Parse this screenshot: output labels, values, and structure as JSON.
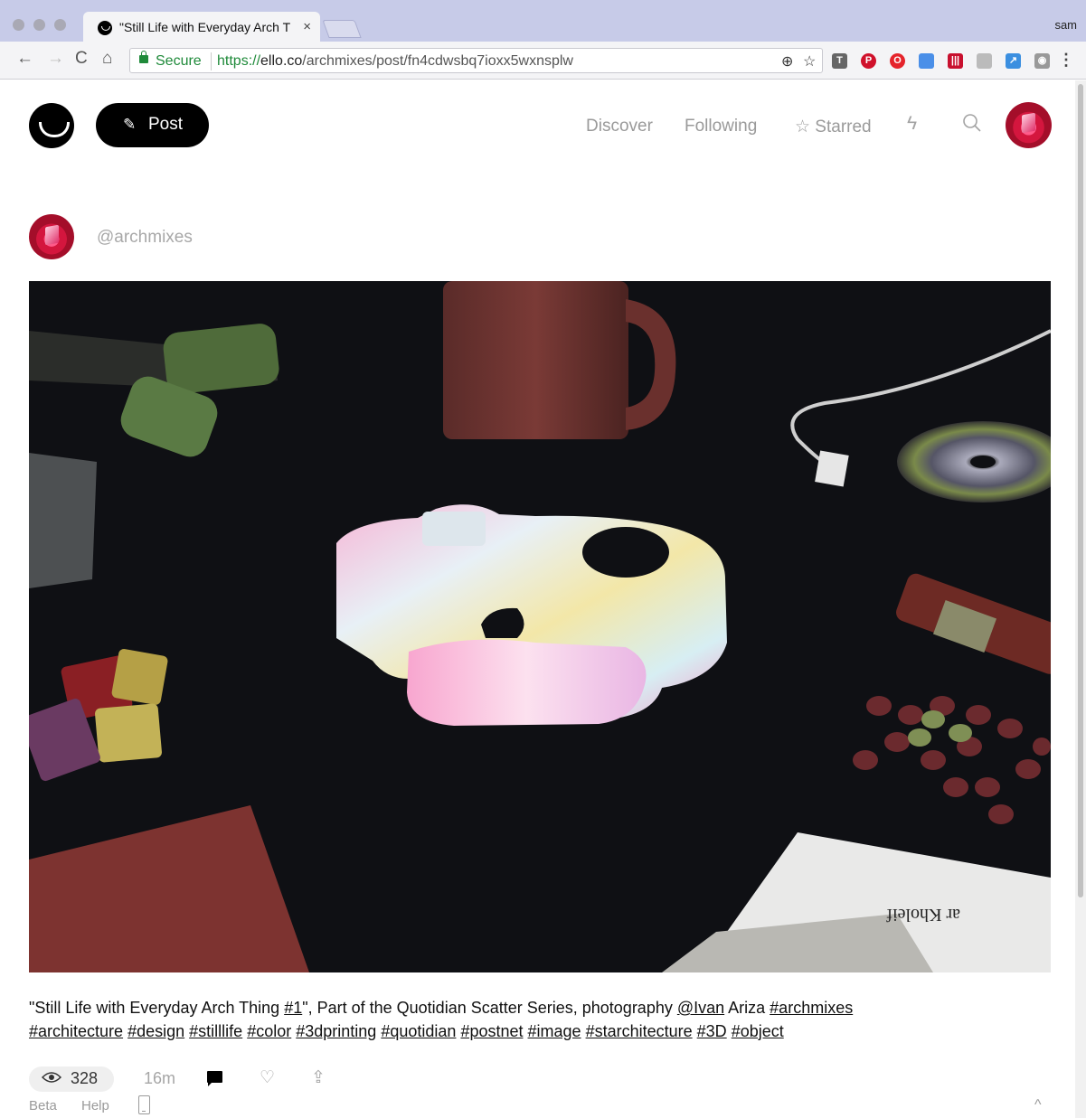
{
  "browser": {
    "tab_title": "\"Still Life with Everyday Arch T",
    "tab_close": "×",
    "profile_name": "sam",
    "secure_label": "Secure",
    "url_scheme": "https://",
    "url_host": "ello.co",
    "url_path": "/archmixes/post/fn4cdwsbq7ioxx5wxnsplw",
    "nav": {
      "back": "←",
      "forward": "→",
      "reload": "C",
      "home": "⌂"
    }
  },
  "header": {
    "post_label": "Post",
    "pencil_glyph": "✎",
    "nav_discover": "Discover",
    "nav_following": "Following",
    "nav_starred": "☆ Starred",
    "lightning_glyph": "ϟ",
    "search_glyph": "○"
  },
  "post": {
    "username": "@archmixes",
    "caption_parts": {
      "p1": "\"Still Life with Everyday Arch Thing ",
      "hash1": "#1",
      "p2": "\", Part of the Quotidian Scatter Series, photography ",
      "mention": "@Ivan",
      "p3": " Ariza ",
      "tags": [
        "#archmixes",
        "#architecture",
        "#design",
        "#stilllife",
        "#color",
        "#3dprinting",
        "#quotidian",
        "#postnet",
        "#image",
        "#starchitecture",
        "#3D",
        "#object"
      ]
    },
    "views": "328",
    "time_ago": "16m",
    "eye_glyph": "👁",
    "heart_glyph": "♡",
    "share_glyph": "⇪",
    "photo_text": "ar Kholeif"
  },
  "footer": {
    "beta": "Beta",
    "help": "Help",
    "chevron": "^"
  },
  "colors": {
    "accent": "#000000",
    "secure_green": "#1f8a3a",
    "titlebar": "#c7cbe8"
  }
}
